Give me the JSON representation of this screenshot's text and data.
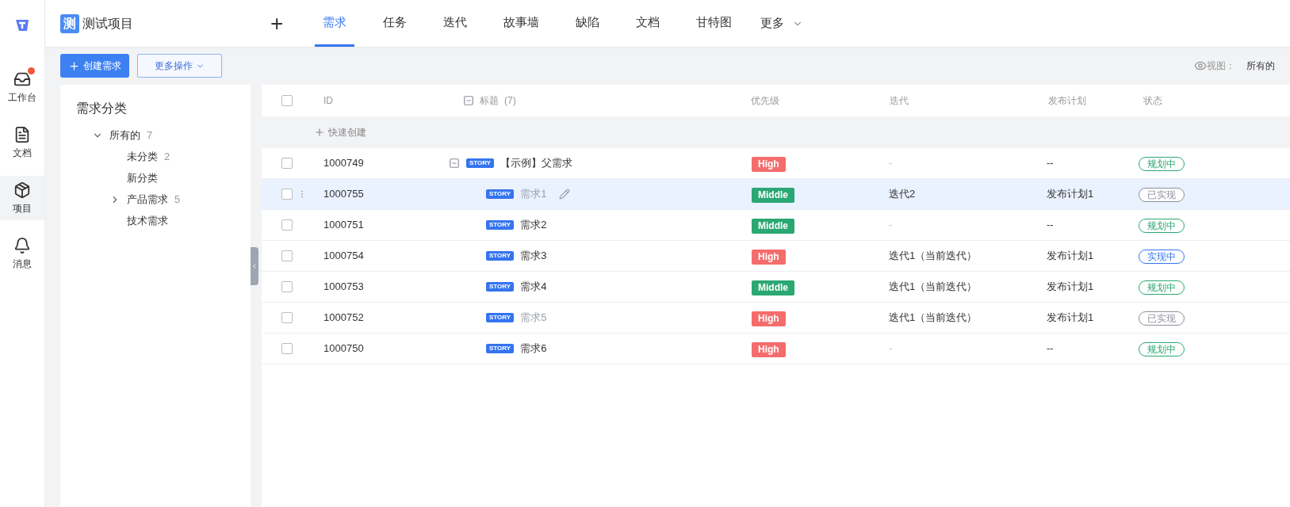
{
  "rail": {
    "items": [
      {
        "label": "工作台",
        "kind": "inbox",
        "selected": false,
        "badge": true
      },
      {
        "label": "文档",
        "kind": "doc",
        "selected": false,
        "badge": false
      },
      {
        "label": "项目",
        "kind": "box",
        "selected": true,
        "badge": false
      },
      {
        "label": "消息",
        "kind": "bell",
        "selected": false,
        "badge": false
      }
    ]
  },
  "project": {
    "badge": "测",
    "name": "测试项目"
  },
  "nav": {
    "add": "+",
    "tabs": [
      {
        "label": "需求",
        "selected": true
      },
      {
        "label": "任务",
        "selected": false
      },
      {
        "label": "迭代",
        "selected": false
      },
      {
        "label": "故事墙",
        "selected": false
      },
      {
        "label": "缺陷",
        "selected": false
      },
      {
        "label": "文档",
        "selected": false
      },
      {
        "label": "甘特图",
        "selected": false
      }
    ],
    "more": "更多"
  },
  "toolbar": {
    "create": "创建需求",
    "more_actions": "更多操作",
    "view_label": "视图：",
    "view_value": "所有的"
  },
  "sidebar": {
    "title": "需求分类",
    "tree": [
      {
        "label": "所有的",
        "count": "7",
        "expanded": true,
        "children": [
          {
            "label": "未分类",
            "count": "2"
          },
          {
            "label": "新分类"
          },
          {
            "label": "产品需求",
            "count": "5",
            "expanded": false
          },
          {
            "label": "技术需求"
          }
        ]
      }
    ]
  },
  "table": {
    "select_all_checked": false,
    "columns": [
      "ID",
      "标题",
      "(7)",
      "优先级",
      "迭代",
      "发布计划",
      "状态"
    ],
    "quick_create": "快速创建",
    "rows": [
      {
        "id": "1000749",
        "checked": false,
        "tag": "STORY",
        "title": "【示例】父需求",
        "done": false,
        "priority": {
          "label": "High",
          "kind": "high"
        },
        "iteration": "-",
        "iteration_muted": true,
        "plan": "--",
        "status": {
          "label": "规划中",
          "kind": "planning"
        },
        "selected": false,
        "expanded": true,
        "children": [
          {
            "id": "1000755",
            "checked": false,
            "tag": "STORY",
            "title": "需求1",
            "done": true,
            "priority": {
              "label": "Middle",
              "kind": "middle"
            },
            "iteration": "迭代2",
            "iteration_muted": false,
            "plan": "发布计划1",
            "status": {
              "label": "已实现",
              "kind": "done"
            },
            "selected": true
          },
          {
            "id": "1000751",
            "checked": false,
            "tag": "STORY",
            "title": "需求2",
            "done": false,
            "priority": {
              "label": "Middle",
              "kind": "middle"
            },
            "iteration": "-",
            "iteration_muted": true,
            "plan": "--",
            "status": {
              "label": "规划中",
              "kind": "planning"
            },
            "selected": false
          },
          {
            "id": "1000754",
            "checked": false,
            "tag": "STORY",
            "title": "需求3",
            "done": false,
            "priority": {
              "label": "High",
              "kind": "high"
            },
            "iteration": "迭代1（当前迭代）",
            "iteration_muted": false,
            "plan": "发布计划1",
            "status": {
              "label": "实现中",
              "kind": "progress"
            },
            "selected": false
          },
          {
            "id": "1000753",
            "checked": false,
            "tag": "STORY",
            "title": "需求4",
            "done": false,
            "priority": {
              "label": "Middle",
              "kind": "middle"
            },
            "iteration": "迭代1（当前迭代）",
            "iteration_muted": false,
            "plan": "发布计划1",
            "status": {
              "label": "规划中",
              "kind": "planning"
            },
            "selected": false
          },
          {
            "id": "1000752",
            "checked": false,
            "tag": "STORY",
            "title": "需求5",
            "done": true,
            "priority": {
              "label": "High",
              "kind": "high"
            },
            "iteration": "迭代1（当前迭代）",
            "iteration_muted": false,
            "plan": "发布计划1",
            "status": {
              "label": "已实现",
              "kind": "done"
            },
            "selected": false
          },
          {
            "id": "1000750",
            "checked": false,
            "tag": "STORY",
            "title": "需求6",
            "done": false,
            "priority": {
              "label": "High",
              "kind": "high"
            },
            "iteration": "-",
            "iteration_muted": true,
            "plan": "--",
            "status": {
              "label": "规划中",
              "kind": "planning"
            },
            "selected": false
          }
        ]
      }
    ]
  }
}
